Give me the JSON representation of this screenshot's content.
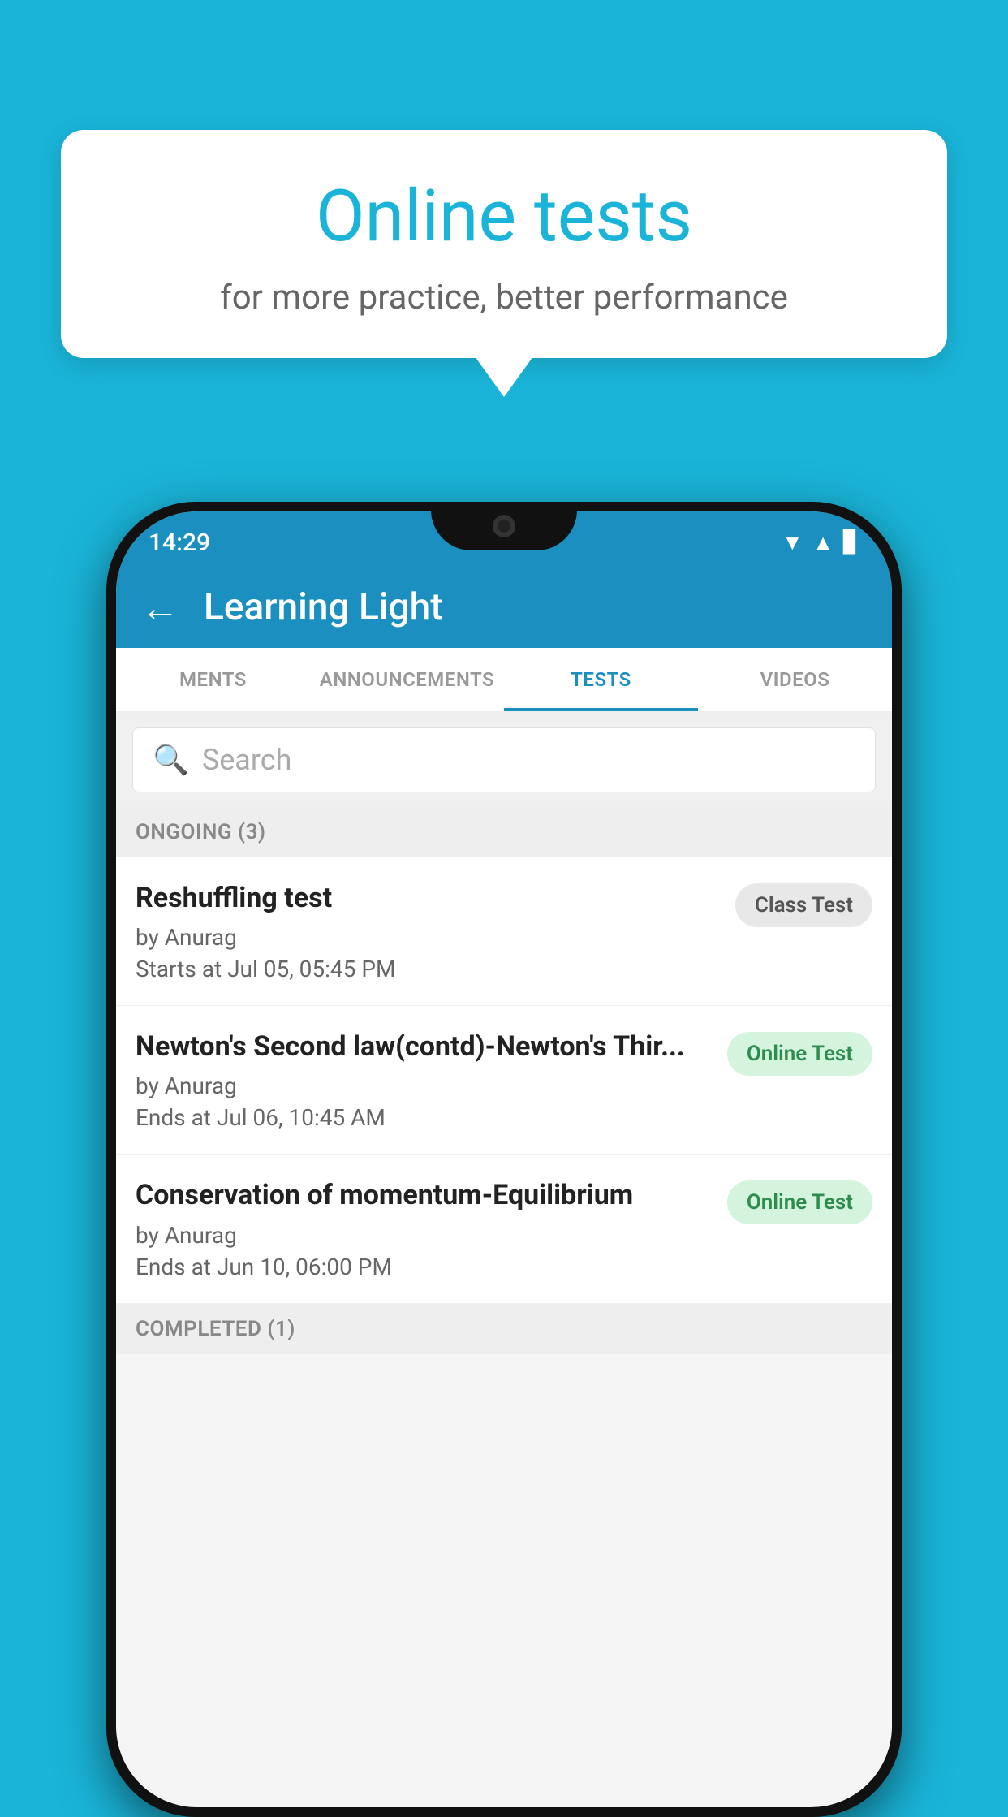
{
  "background_color": "#1ab4d8",
  "bubble": {
    "title": "Online tests",
    "subtitle": "for more practice, better performance"
  },
  "phone": {
    "status_bar": {
      "time": "14:29",
      "icons": [
        "wifi",
        "signal",
        "battery"
      ]
    },
    "app_bar": {
      "title": "Learning Light",
      "back_label": "←"
    },
    "tabs": [
      {
        "label": "MENTS",
        "active": false
      },
      {
        "label": "ANNOUNCEMENTS",
        "active": false
      },
      {
        "label": "TESTS",
        "active": true
      },
      {
        "label": "VIDEOS",
        "active": false
      }
    ],
    "search": {
      "placeholder": "Search"
    },
    "sections": [
      {
        "label": "ONGOING (3)",
        "tests": [
          {
            "name": "Reshuffling test",
            "author": "by Anurag",
            "time": "Starts at  Jul 05, 05:45 PM",
            "badge": "Class Test",
            "badge_type": "class"
          },
          {
            "name": "Newton's Second law(contd)-Newton's Thir...",
            "author": "by Anurag",
            "time": "Ends at  Jul 06, 10:45 AM",
            "badge": "Online Test",
            "badge_type": "online"
          },
          {
            "name": "Conservation of momentum-Equilibrium",
            "author": "by Anurag",
            "time": "Ends at  Jun 10, 06:00 PM",
            "badge": "Online Test",
            "badge_type": "online"
          }
        ]
      },
      {
        "label": "COMPLETED (1)",
        "tests": []
      }
    ]
  }
}
